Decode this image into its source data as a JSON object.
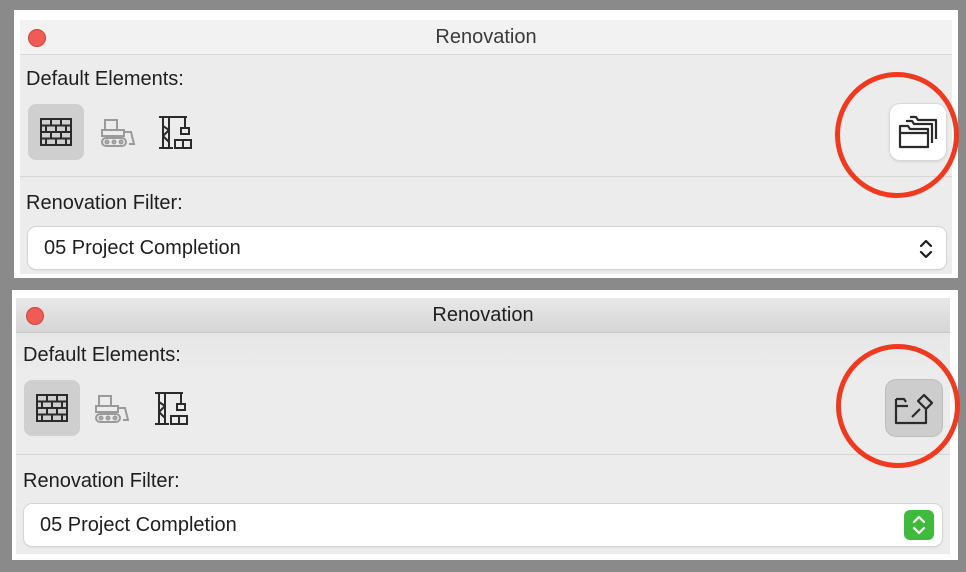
{
  "panels": [
    {
      "id": "active",
      "title": "Renovation",
      "default_elements_label": "Default Elements:",
      "renovation_filter_label": "Renovation Filter:",
      "filter_value": "05 Project Completion",
      "right_button_icon": "folders-icon",
      "dropdown_arrow_style": "plain"
    },
    {
      "id": "inactive",
      "title": "Renovation",
      "default_elements_label": "Default Elements:",
      "renovation_filter_label": "Renovation Filter:",
      "filter_value": "05 Project Completion",
      "right_button_icon": "pin-to-folder-icon",
      "dropdown_arrow_style": "green"
    }
  ],
  "segment_icons": [
    "brick-wall-icon",
    "bulldozer-icon",
    "crane-icon"
  ],
  "colors": {
    "callout": "#f03a1f",
    "close_button": "#ee5c55",
    "panel_bg": "#ececec",
    "dropdown_arrow_active": "#3fba3c"
  }
}
